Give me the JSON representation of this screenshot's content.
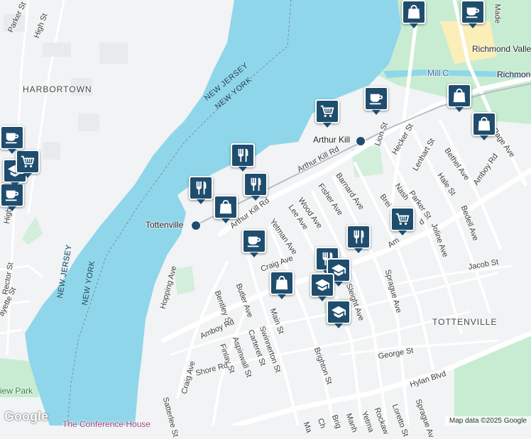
{
  "map": {
    "water_color": "#8fd6ea",
    "land_color": "#f1f3f4",
    "park_color": "#c8ecd2",
    "pin_color": "#1f4d6e"
  },
  "labels": {
    "harbortown": "HARBORTOWN",
    "tottenville_area": "TOTTENVILLE",
    "nj_ny_top_1": "NEW JERSEY",
    "nj_ny_top_2": "NEW YORK",
    "nj_bottom": "NEW JERSEY",
    "ny_bottom": "NEW YORK",
    "tottenville_station": "Tottenville",
    "arthur_kill_station": "Arthur Kill",
    "conference_house": "The Conference House",
    "view_park": "iew Park",
    "mill_creek": "Mill C",
    "richmond_valley": "Richmond Valle",
    "richmond": "Richmon",
    "made": "Made"
  },
  "streets": {
    "parker_st_nw": "Parker St",
    "high_st": "High St",
    "high_st_2": "High",
    "rector_st": "Rector St",
    "fayette_st": "ayette St",
    "arthur_kill_rd_1": "Arthur Kill Rd",
    "arthur_kill_rd_2": "Arthur Kill Rd",
    "lion_st": "Lion St",
    "hecker_st": "Hecker St",
    "lenhart_st": "Lenhart St",
    "bethel_ave": "Bethel Ave",
    "page_ave": "Page Ave",
    "amboy_rd_e": "Amboy Rd",
    "barnard_ave": "Barnard Ave",
    "fisher_ave": "Fisher Ave",
    "wood_ave": "Wood Ave",
    "lee_ave": "Lee Ave",
    "yetman_ave": "Yetman Ave",
    "parker_st": "Parker St",
    "hale_st": "Hale St",
    "nash": "Nash",
    "brei": "Brei",
    "joline_ave": "Joline Ave",
    "bedell_ave": "Bedell Ave",
    "amboy_rd_mid": "Am",
    "rd_mid": "d",
    "craig_ave_top": "Craig Ave",
    "jacob_st": "Jacob St",
    "sprague_ave": "Sprague Ave",
    "sleight_ave": "Sleight Ave",
    "hopping_ave": "Hopping Ave",
    "butler_ave": "Butler Ave",
    "bentley_st": "Bentley St",
    "main_st": "Main St",
    "amboy_rd_w": "Amboy Rd",
    "aspinwall_st": "Aspinwall St",
    "carteret_st": "Carteret St",
    "swinnerton_st": "Swinnerton St",
    "finlay_st": "Finlay St",
    "shore_rd": "Shore Rd",
    "craig_ave": "Craig Ave",
    "satterlee_st": "Satterlee St",
    "brighton_st": "Brighton St",
    "george_st": "George St",
    "hylan_blvd": "Hylan Blvd",
    "ch": "Ch",
    "brig": "Brig",
    "manh": "Manh",
    "yetma": "Yetma",
    "rockaw": "Rockaw",
    "loretto_st": "Loretto St",
    "sprague_av": "Sprague Av",
    "ma": "Ma"
  },
  "pins": [
    {
      "name": "restaurant-pin-1",
      "icon": "restaurant-icon"
    },
    {
      "name": "restaurant-pin-2",
      "icon": "restaurant-icon"
    },
    {
      "name": "restaurant-pin-3",
      "icon": "restaurant-icon"
    },
    {
      "name": "shopping-bag-pin-1",
      "icon": "shopping-bag-icon"
    },
    {
      "name": "cafe-pin-1",
      "icon": "cafe-icon"
    },
    {
      "name": "shopping-bag-pin-2",
      "icon": "shopping-bag-icon"
    },
    {
      "name": "grocery-pin-1",
      "icon": "grocery-cart-icon"
    },
    {
      "name": "cafe-pin-2",
      "icon": "cafe-icon"
    },
    {
      "name": "shopping-bag-pin-3",
      "icon": "shopping-bag-icon"
    },
    {
      "name": "shopping-bag-pin-4",
      "icon": "shopping-bag-icon"
    },
    {
      "name": "cafe-pin-3",
      "icon": "cafe-icon"
    },
    {
      "name": "cafe-pin-4",
      "icon": "cafe-icon"
    },
    {
      "name": "school-pin-1",
      "icon": "school-icon"
    },
    {
      "name": "grocery-pin-2",
      "icon": "grocery-cart-icon"
    },
    {
      "name": "cafe-pin-5",
      "icon": "cafe-icon"
    },
    {
      "name": "shopping-bag-pin-5",
      "icon": "shopping-bag-icon"
    },
    {
      "name": "grocery-pin-3",
      "icon": "grocery-cart-icon"
    },
    {
      "name": "restaurant-pin-4",
      "icon": "restaurant-icon"
    },
    {
      "name": "restaurant-pin-5",
      "icon": "restaurant-icon"
    },
    {
      "name": "school-pin-2",
      "icon": "school-icon"
    },
    {
      "name": "school-pin-3",
      "icon": "school-icon"
    },
    {
      "name": "school-pin-4",
      "icon": "school-icon"
    }
  ],
  "footer": {
    "google": "Google",
    "attribution": "Map data ©2025 Google"
  }
}
